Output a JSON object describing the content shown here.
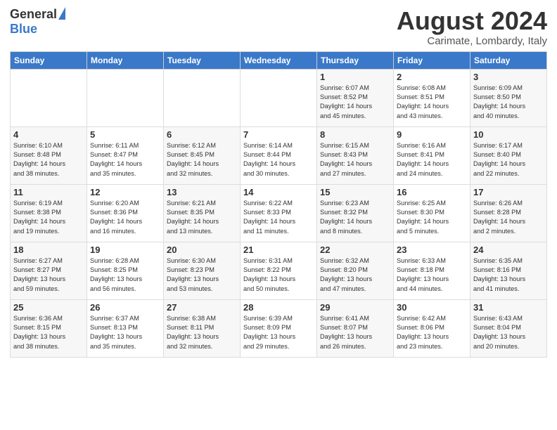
{
  "logo": {
    "general": "General",
    "blue": "Blue"
  },
  "header": {
    "title": "August 2024",
    "subtitle": "Carimate, Lombardy, Italy"
  },
  "weekdays": [
    "Sunday",
    "Monday",
    "Tuesday",
    "Wednesday",
    "Thursday",
    "Friday",
    "Saturday"
  ],
  "weeks": [
    [
      {
        "day": "",
        "info": ""
      },
      {
        "day": "",
        "info": ""
      },
      {
        "day": "",
        "info": ""
      },
      {
        "day": "",
        "info": ""
      },
      {
        "day": "1",
        "info": "Sunrise: 6:07 AM\nSunset: 8:52 PM\nDaylight: 14 hours\nand 45 minutes."
      },
      {
        "day": "2",
        "info": "Sunrise: 6:08 AM\nSunset: 8:51 PM\nDaylight: 14 hours\nand 43 minutes."
      },
      {
        "day": "3",
        "info": "Sunrise: 6:09 AM\nSunset: 8:50 PM\nDaylight: 14 hours\nand 40 minutes."
      }
    ],
    [
      {
        "day": "4",
        "info": "Sunrise: 6:10 AM\nSunset: 8:48 PM\nDaylight: 14 hours\nand 38 minutes."
      },
      {
        "day": "5",
        "info": "Sunrise: 6:11 AM\nSunset: 8:47 PM\nDaylight: 14 hours\nand 35 minutes."
      },
      {
        "day": "6",
        "info": "Sunrise: 6:12 AM\nSunset: 8:45 PM\nDaylight: 14 hours\nand 32 minutes."
      },
      {
        "day": "7",
        "info": "Sunrise: 6:14 AM\nSunset: 8:44 PM\nDaylight: 14 hours\nand 30 minutes."
      },
      {
        "day": "8",
        "info": "Sunrise: 6:15 AM\nSunset: 8:43 PM\nDaylight: 14 hours\nand 27 minutes."
      },
      {
        "day": "9",
        "info": "Sunrise: 6:16 AM\nSunset: 8:41 PM\nDaylight: 14 hours\nand 24 minutes."
      },
      {
        "day": "10",
        "info": "Sunrise: 6:17 AM\nSunset: 8:40 PM\nDaylight: 14 hours\nand 22 minutes."
      }
    ],
    [
      {
        "day": "11",
        "info": "Sunrise: 6:19 AM\nSunset: 8:38 PM\nDaylight: 14 hours\nand 19 minutes."
      },
      {
        "day": "12",
        "info": "Sunrise: 6:20 AM\nSunset: 8:36 PM\nDaylight: 14 hours\nand 16 minutes."
      },
      {
        "day": "13",
        "info": "Sunrise: 6:21 AM\nSunset: 8:35 PM\nDaylight: 14 hours\nand 13 minutes."
      },
      {
        "day": "14",
        "info": "Sunrise: 6:22 AM\nSunset: 8:33 PM\nDaylight: 14 hours\nand 11 minutes."
      },
      {
        "day": "15",
        "info": "Sunrise: 6:23 AM\nSunset: 8:32 PM\nDaylight: 14 hours\nand 8 minutes."
      },
      {
        "day": "16",
        "info": "Sunrise: 6:25 AM\nSunset: 8:30 PM\nDaylight: 14 hours\nand 5 minutes."
      },
      {
        "day": "17",
        "info": "Sunrise: 6:26 AM\nSunset: 8:28 PM\nDaylight: 14 hours\nand 2 minutes."
      }
    ],
    [
      {
        "day": "18",
        "info": "Sunrise: 6:27 AM\nSunset: 8:27 PM\nDaylight: 13 hours\nand 59 minutes."
      },
      {
        "day": "19",
        "info": "Sunrise: 6:28 AM\nSunset: 8:25 PM\nDaylight: 13 hours\nand 56 minutes."
      },
      {
        "day": "20",
        "info": "Sunrise: 6:30 AM\nSunset: 8:23 PM\nDaylight: 13 hours\nand 53 minutes."
      },
      {
        "day": "21",
        "info": "Sunrise: 6:31 AM\nSunset: 8:22 PM\nDaylight: 13 hours\nand 50 minutes."
      },
      {
        "day": "22",
        "info": "Sunrise: 6:32 AM\nSunset: 8:20 PM\nDaylight: 13 hours\nand 47 minutes."
      },
      {
        "day": "23",
        "info": "Sunrise: 6:33 AM\nSunset: 8:18 PM\nDaylight: 13 hours\nand 44 minutes."
      },
      {
        "day": "24",
        "info": "Sunrise: 6:35 AM\nSunset: 8:16 PM\nDaylight: 13 hours\nand 41 minutes."
      }
    ],
    [
      {
        "day": "25",
        "info": "Sunrise: 6:36 AM\nSunset: 8:15 PM\nDaylight: 13 hours\nand 38 minutes."
      },
      {
        "day": "26",
        "info": "Sunrise: 6:37 AM\nSunset: 8:13 PM\nDaylight: 13 hours\nand 35 minutes."
      },
      {
        "day": "27",
        "info": "Sunrise: 6:38 AM\nSunset: 8:11 PM\nDaylight: 13 hours\nand 32 minutes."
      },
      {
        "day": "28",
        "info": "Sunrise: 6:39 AM\nSunset: 8:09 PM\nDaylight: 13 hours\nand 29 minutes."
      },
      {
        "day": "29",
        "info": "Sunrise: 6:41 AM\nSunset: 8:07 PM\nDaylight: 13 hours\nand 26 minutes."
      },
      {
        "day": "30",
        "info": "Sunrise: 6:42 AM\nSunset: 8:06 PM\nDaylight: 13 hours\nand 23 minutes."
      },
      {
        "day": "31",
        "info": "Sunrise: 6:43 AM\nSunset: 8:04 PM\nDaylight: 13 hours\nand 20 minutes."
      }
    ]
  ]
}
